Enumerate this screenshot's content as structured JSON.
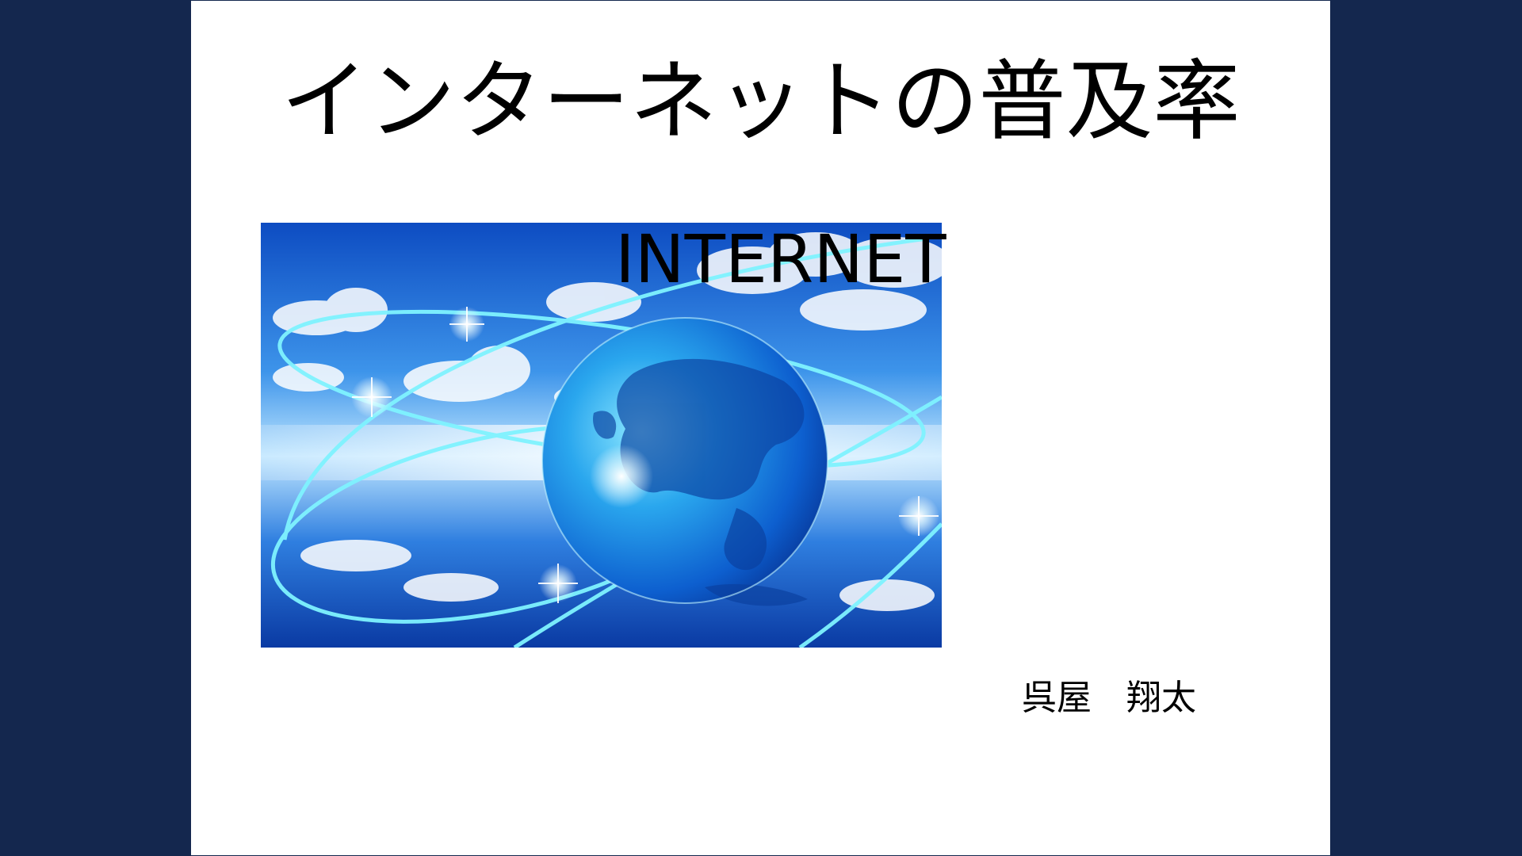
{
  "slide": {
    "title": "インターネットの普及率",
    "image": {
      "icon": "globe-network-image",
      "caption": "INTERNET"
    },
    "author": "呉屋　翔太"
  },
  "colors": {
    "frame_background": "#14274e",
    "slide_background": "#ffffff",
    "text": "#000000",
    "sky_light": "#5fb0f0",
    "sky_deep": "#0a3fa8",
    "orbit_glow": "#7ff3ff"
  }
}
